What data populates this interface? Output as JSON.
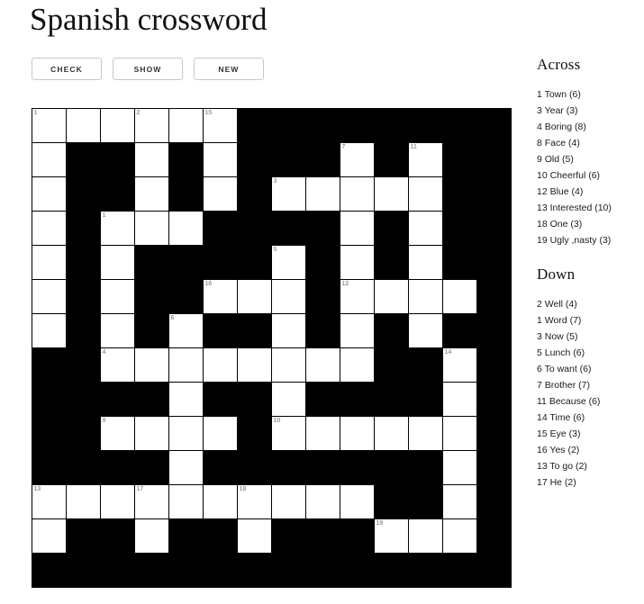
{
  "page": {
    "title": "Spanish crossword"
  },
  "toolbar": {
    "buttons": [
      {
        "label": "CHECK",
        "name": "check-button"
      },
      {
        "label": "SHOW",
        "name": "show-button"
      },
      {
        "label": "NEW",
        "name": "new-button"
      }
    ]
  },
  "clues": {
    "across_heading": "Across",
    "down_heading": "Down",
    "across": [
      "1 Town (6)",
      "3 Year (3)",
      "4 Boring (8)",
      "8 Face (4)",
      "9 Old (5)",
      "10 Cheerful (6)",
      "12 Blue (4)",
      "13 Interested (10)",
      "18 One (3)",
      "19 Ugly ,nasty (3)"
    ],
    "down": [
      "2 Well (4)",
      "1 Word (7)",
      "3 Now (5)",
      "5 Lunch (6)",
      "6 To want (6)",
      "7 Brother (7)",
      "11 Because (6)",
      "14 Time (6)",
      "15 Eye (3)",
      "16 Yes (2)",
      "13 To go (2)",
      "17 He (2)"
    ]
  },
  "grid": {
    "columns": 14,
    "rows": 14,
    "cell_size_px": 38,
    "block_color": "#000000",
    "light_color": "#ffffff",
    "number_color": "#9a9a9a",
    "cells": [
      [
        {
          "t": "light",
          "n": "1",
          "v": ""
        },
        {
          "t": "light",
          "n": "",
          "v": ""
        },
        {
          "t": "light",
          "n": "",
          "v": ""
        },
        {
          "t": "light",
          "n": "2",
          "v": ""
        },
        {
          "t": "light",
          "n": "",
          "v": ""
        },
        {
          "t": "light",
          "n": "15",
          "v": ""
        },
        {
          "t": "block"
        },
        {
          "t": "block"
        },
        {
          "t": "block"
        },
        {
          "t": "block"
        },
        {
          "t": "block"
        },
        {
          "t": "block"
        },
        {
          "t": "block"
        },
        {
          "t": "block"
        }
      ],
      [
        {
          "t": "light",
          "n": "",
          "v": ""
        },
        {
          "t": "block"
        },
        {
          "t": "block"
        },
        {
          "t": "light",
          "n": "",
          "v": ""
        },
        {
          "t": "block"
        },
        {
          "t": "light",
          "n": "",
          "v": ""
        },
        {
          "t": "block"
        },
        {
          "t": "block"
        },
        {
          "t": "block"
        },
        {
          "t": "light",
          "n": "7",
          "v": ""
        },
        {
          "t": "block"
        },
        {
          "t": "light",
          "n": "11",
          "v": ""
        },
        {
          "t": "block"
        },
        {
          "t": "block"
        }
      ],
      [
        {
          "t": "light",
          "n": "",
          "v": ""
        },
        {
          "t": "block"
        },
        {
          "t": "block"
        },
        {
          "t": "light",
          "n": "",
          "v": ""
        },
        {
          "t": "block"
        },
        {
          "t": "light",
          "n": "",
          "v": ""
        },
        {
          "t": "block"
        },
        {
          "t": "light",
          "n": "3",
          "v": ""
        },
        {
          "t": "light",
          "n": "",
          "v": ""
        },
        {
          "t": "light",
          "n": "",
          "v": ""
        },
        {
          "t": "light",
          "n": "",
          "v": ""
        },
        {
          "t": "light",
          "n": "",
          "v": ""
        },
        {
          "t": "block"
        },
        {
          "t": "block"
        }
      ],
      [
        {
          "t": "light",
          "n": "",
          "v": ""
        },
        {
          "t": "block"
        },
        {
          "t": "light",
          "n": "1",
          "v": ""
        },
        {
          "t": "light",
          "n": "",
          "v": ""
        },
        {
          "t": "light",
          "n": "",
          "v": ""
        },
        {
          "t": "block"
        },
        {
          "t": "block"
        },
        {
          "t": "block"
        },
        {
          "t": "block"
        },
        {
          "t": "light",
          "n": "",
          "v": ""
        },
        {
          "t": "block"
        },
        {
          "t": "light",
          "n": "",
          "v": ""
        },
        {
          "t": "block"
        },
        {
          "t": "block"
        }
      ],
      [
        {
          "t": "light",
          "n": "",
          "v": ""
        },
        {
          "t": "block"
        },
        {
          "t": "light",
          "n": "",
          "v": ""
        },
        {
          "t": "block"
        },
        {
          "t": "block"
        },
        {
          "t": "block"
        },
        {
          "t": "block"
        },
        {
          "t": "light",
          "n": "5",
          "v": ""
        },
        {
          "t": "block"
        },
        {
          "t": "light",
          "n": "",
          "v": ""
        },
        {
          "t": "block"
        },
        {
          "t": "light",
          "n": "",
          "v": ""
        },
        {
          "t": "block"
        },
        {
          "t": "block"
        }
      ],
      [
        {
          "t": "light",
          "n": "",
          "v": ""
        },
        {
          "t": "block"
        },
        {
          "t": "light",
          "n": "",
          "v": ""
        },
        {
          "t": "block"
        },
        {
          "t": "block"
        },
        {
          "t": "light",
          "n": "16",
          "v": ""
        },
        {
          "t": "light",
          "n": "",
          "v": ""
        },
        {
          "t": "light",
          "n": "",
          "v": ""
        },
        {
          "t": "block"
        },
        {
          "t": "light",
          "n": "12",
          "v": ""
        },
        {
          "t": "light",
          "n": "",
          "v": ""
        },
        {
          "t": "light",
          "n": "",
          "v": ""
        },
        {
          "t": "light",
          "n": "",
          "v": ""
        },
        {
          "t": "block"
        }
      ],
      [
        {
          "t": "light",
          "n": "",
          "v": ""
        },
        {
          "t": "block"
        },
        {
          "t": "light",
          "n": "",
          "v": ""
        },
        {
          "t": "block"
        },
        {
          "t": "light",
          "n": "6",
          "v": ""
        },
        {
          "t": "block"
        },
        {
          "t": "block"
        },
        {
          "t": "light",
          "n": "",
          "v": ""
        },
        {
          "t": "block"
        },
        {
          "t": "light",
          "n": "",
          "v": ""
        },
        {
          "t": "block"
        },
        {
          "t": "light",
          "n": "",
          "v": ""
        },
        {
          "t": "block"
        },
        {
          "t": "block"
        }
      ],
      [
        {
          "t": "block"
        },
        {
          "t": "block"
        },
        {
          "t": "light",
          "n": "4",
          "v": ""
        },
        {
          "t": "light",
          "n": "",
          "v": ""
        },
        {
          "t": "light",
          "n": "",
          "v": ""
        },
        {
          "t": "light",
          "n": "",
          "v": ""
        },
        {
          "t": "light",
          "n": "",
          "v": ""
        },
        {
          "t": "light",
          "n": "",
          "v": ""
        },
        {
          "t": "light",
          "n": "",
          "v": ""
        },
        {
          "t": "light",
          "n": "",
          "v": ""
        },
        {
          "t": "block"
        },
        {
          "t": "block"
        },
        {
          "t": "light",
          "n": "14",
          "v": ""
        },
        {
          "t": "block"
        }
      ],
      [
        {
          "t": "block"
        },
        {
          "t": "block"
        },
        {
          "t": "block"
        },
        {
          "t": "block"
        },
        {
          "t": "light",
          "n": "",
          "v": ""
        },
        {
          "t": "block"
        },
        {
          "t": "block"
        },
        {
          "t": "light",
          "n": "",
          "v": ""
        },
        {
          "t": "block"
        },
        {
          "t": "block"
        },
        {
          "t": "block"
        },
        {
          "t": "block"
        },
        {
          "t": "light",
          "n": "",
          "v": ""
        },
        {
          "t": "block"
        }
      ],
      [
        {
          "t": "block"
        },
        {
          "t": "block"
        },
        {
          "t": "light",
          "n": "9",
          "v": ""
        },
        {
          "t": "light",
          "n": "",
          "v": ""
        },
        {
          "t": "light",
          "n": "",
          "v": ""
        },
        {
          "t": "light",
          "n": "",
          "v": ""
        },
        {
          "t": "block"
        },
        {
          "t": "light",
          "n": "10",
          "v": ""
        },
        {
          "t": "light",
          "n": "",
          "v": ""
        },
        {
          "t": "light",
          "n": "",
          "v": ""
        },
        {
          "t": "light",
          "n": "",
          "v": ""
        },
        {
          "t": "light",
          "n": "",
          "v": ""
        },
        {
          "t": "light",
          "n": "",
          "v": ""
        },
        {
          "t": "block"
        }
      ],
      [
        {
          "t": "block"
        },
        {
          "t": "block"
        },
        {
          "t": "block"
        },
        {
          "t": "block"
        },
        {
          "t": "light",
          "n": "",
          "v": ""
        },
        {
          "t": "block"
        },
        {
          "t": "block"
        },
        {
          "t": "block"
        },
        {
          "t": "block"
        },
        {
          "t": "block"
        },
        {
          "t": "block"
        },
        {
          "t": "block"
        },
        {
          "t": "light",
          "n": "",
          "v": ""
        },
        {
          "t": "block"
        }
      ],
      [
        {
          "t": "light",
          "n": "13",
          "v": ""
        },
        {
          "t": "light",
          "n": "",
          "v": ""
        },
        {
          "t": "light",
          "n": "",
          "v": ""
        },
        {
          "t": "light",
          "n": "17",
          "v": ""
        },
        {
          "t": "light",
          "n": "",
          "v": ""
        },
        {
          "t": "light",
          "n": "",
          "v": ""
        },
        {
          "t": "light",
          "n": "18",
          "v": ""
        },
        {
          "t": "light",
          "n": "",
          "v": ""
        },
        {
          "t": "light",
          "n": "",
          "v": ""
        },
        {
          "t": "light",
          "n": "",
          "v": ""
        },
        {
          "t": "block"
        },
        {
          "t": "block"
        },
        {
          "t": "light",
          "n": "",
          "v": ""
        },
        {
          "t": "block"
        }
      ],
      [
        {
          "t": "light",
          "n": "",
          "v": ""
        },
        {
          "t": "block"
        },
        {
          "t": "block"
        },
        {
          "t": "light",
          "n": "",
          "v": ""
        },
        {
          "t": "block"
        },
        {
          "t": "block"
        },
        {
          "t": "light",
          "n": "",
          "v": ""
        },
        {
          "t": "block"
        },
        {
          "t": "block"
        },
        {
          "t": "block"
        },
        {
          "t": "light",
          "n": "19",
          "v": ""
        },
        {
          "t": "light",
          "n": "",
          "v": ""
        },
        {
          "t": "light",
          "n": "",
          "v": ""
        },
        {
          "t": "block"
        }
      ],
      [
        {
          "t": "block"
        },
        {
          "t": "block"
        },
        {
          "t": "block"
        },
        {
          "t": "block"
        },
        {
          "t": "block"
        },
        {
          "t": "block"
        },
        {
          "t": "block"
        },
        {
          "t": "block"
        },
        {
          "t": "block"
        },
        {
          "t": "block"
        },
        {
          "t": "block"
        },
        {
          "t": "block"
        },
        {
          "t": "block"
        },
        {
          "t": "block"
        }
      ]
    ]
  }
}
